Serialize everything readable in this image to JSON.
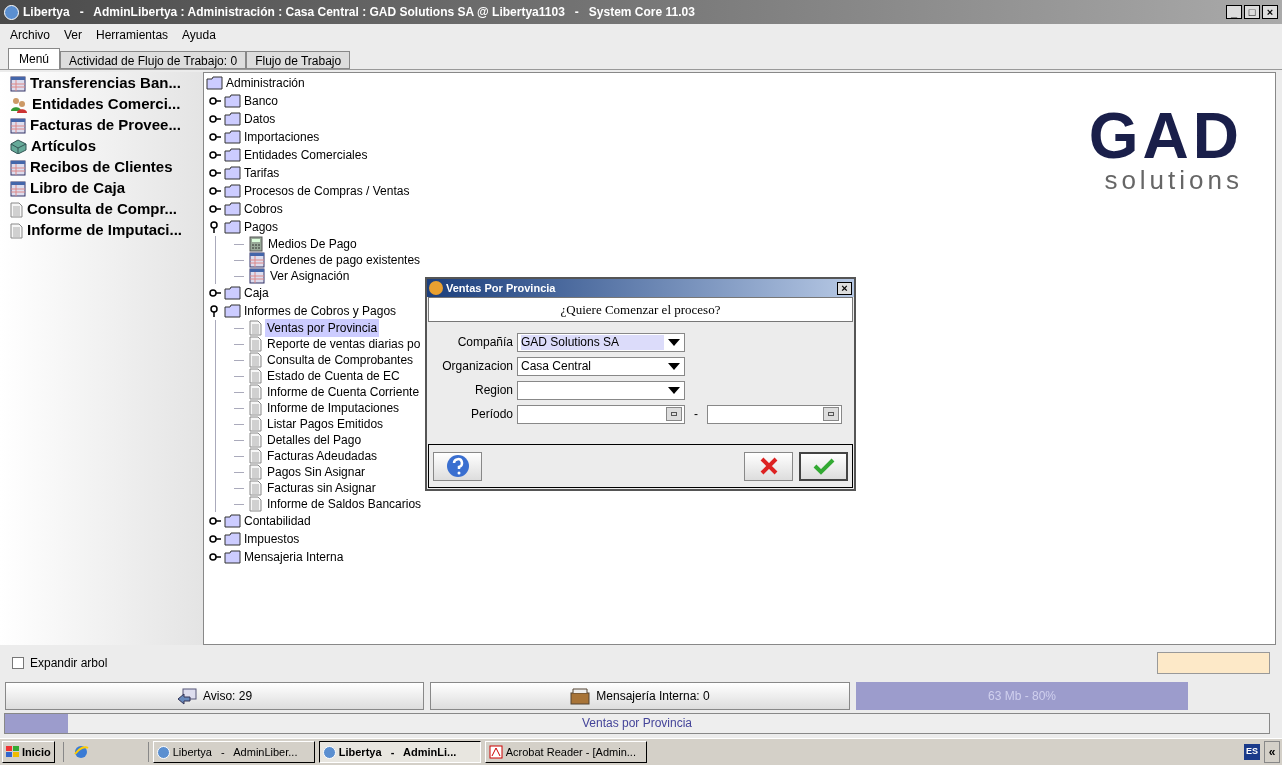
{
  "window": {
    "title": "Libertya   -   AdminLibertya : Administración : Casa Central : GAD Solutions SA @ Libertya1103   -   System Core 11.03",
    "controls": [
      "_",
      "□",
      "×"
    ]
  },
  "menu": [
    "Archivo",
    "Ver",
    "Herramientas",
    "Ayuda"
  ],
  "tabs": [
    {
      "label": "Menú",
      "selected": true
    },
    {
      "label": "Actividad de Flujo de Trabajo: 0",
      "selected": false
    },
    {
      "label": "Flujo de Trabajo",
      "selected": false
    }
  ],
  "favorites": [
    {
      "label": "Transferencias Ban...",
      "kind": "window"
    },
    {
      "label": "Entidades Comerci...",
      "kind": "people"
    },
    {
      "label": "Facturas de Provee...",
      "kind": "window"
    },
    {
      "label": "Artículos",
      "kind": "product"
    },
    {
      "label": "Recibos de Clientes",
      "kind": "window"
    },
    {
      "label": "Libro de Caja",
      "kind": "window"
    },
    {
      "label": "Consulta de Compr...",
      "kind": "report"
    },
    {
      "label": "Informe de Imputaci...",
      "kind": "report"
    }
  ],
  "tree": {
    "label": "Administración",
    "children": [
      {
        "label": "Banco",
        "kind": "folder",
        "expanded": false
      },
      {
        "label": "Datos",
        "kind": "folder",
        "expanded": false
      },
      {
        "label": "Importaciones",
        "kind": "folder",
        "expanded": false
      },
      {
        "label": "Entidades Comerciales",
        "kind": "folder",
        "expanded": false
      },
      {
        "label": "Tarifas",
        "kind": "folder",
        "expanded": false
      },
      {
        "label": "Procesos de Compras / Ventas",
        "kind": "folder",
        "expanded": false
      },
      {
        "label": "Cobros",
        "kind": "folder",
        "expanded": false
      },
      {
        "label": "Pagos",
        "kind": "folder",
        "expanded": true,
        "children": [
          {
            "label": "Medios De Pago",
            "kind": "process",
            "selected": false
          },
          {
            "label": "Ordenes de pago existentes",
            "kind": "window",
            "selected": false
          },
          {
            "label": "Ver Asignación",
            "kind": "window",
            "selected": false
          }
        ]
      },
      {
        "label": "Caja",
        "kind": "folder",
        "expanded": false
      },
      {
        "label": "Informes de Cobros y Pagos",
        "kind": "folder",
        "expanded": true,
        "children": [
          {
            "label": "Ventas por Provincia",
            "kind": "report",
            "selected": true
          },
          {
            "label": "Reporte de ventas diarias po",
            "kind": "report",
            "selected": false
          },
          {
            "label": "Consulta de Comprobantes",
            "kind": "report",
            "selected": false
          },
          {
            "label": "Estado de Cuenta de EC",
            "kind": "report",
            "selected": false
          },
          {
            "label": "Informe de Cuenta Corriente",
            "kind": "report",
            "selected": false
          },
          {
            "label": "Informe de Imputaciones",
            "kind": "report",
            "selected": false
          },
          {
            "label": "Listar Pagos Emitidos",
            "kind": "report",
            "selected": false
          },
          {
            "label": "Detalles del Pago",
            "kind": "report",
            "selected": false
          },
          {
            "label": "Facturas Adeudadas",
            "kind": "report",
            "selected": false
          },
          {
            "label": "Pagos Sin Asignar",
            "kind": "report",
            "selected": false
          },
          {
            "label": "Facturas sin Asignar",
            "kind": "report",
            "selected": false
          },
          {
            "label": "Informe de Saldos Bancarios",
            "kind": "report",
            "selected": false
          }
        ]
      },
      {
        "label": "Contabilidad",
        "kind": "folder",
        "expanded": false
      },
      {
        "label": "Impuestos",
        "kind": "folder",
        "expanded": false
      },
      {
        "label": "Mensajeria Interna",
        "kind": "folder",
        "expanded": false
      }
    ]
  },
  "logo": {
    "name": "GAD",
    "tagline": "solutions"
  },
  "expand_tree": {
    "label": "Expandir arbol",
    "checked": false
  },
  "dialog": {
    "title": "Ventas Por Provincia",
    "close": "×",
    "question": "¿Quiere Comenzar el proceso?",
    "fields": [
      {
        "label": "Compañía",
        "kind": "select",
        "value": "GAD Solutions SA",
        "selected": true
      },
      {
        "label": "Organizacion",
        "kind": "select",
        "value": "Casa Central",
        "selected": false
      },
      {
        "label": "Region",
        "kind": "select",
        "selected": false
      },
      {
        "label": "Período",
        "kind": "date_range",
        "separator": "-"
      }
    ]
  },
  "status_bar": {
    "notices": "Aviso: 29",
    "messages": "Mensajería Interna: 0",
    "memory": {
      "text": "63 Mb - 80%",
      "level": 0.8
    }
  },
  "progress": {
    "text": "Ventas por Provincia",
    "level": 0.05
  },
  "taskbar": {
    "start": "Inicio",
    "tasks": [
      {
        "label": "Libertya   -   AdminLiber...",
        "kind": "app",
        "selected": false
      },
      {
        "label": "Libertya   -   AdminLi...",
        "kind": "app",
        "selected": true
      },
      {
        "label": "Acrobat Reader - [Admin...",
        "kind": "pdf",
        "selected": false
      }
    ],
    "language": "ES",
    "tray_toggle": "«"
  }
}
